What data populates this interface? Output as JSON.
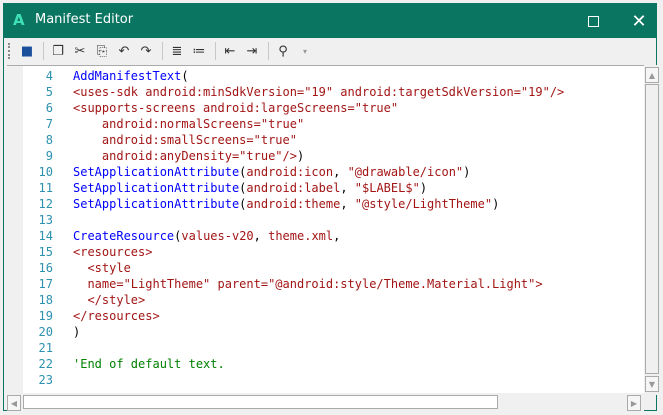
{
  "window": {
    "title": "Manifest Editor",
    "app_icon": "A"
  },
  "toolbar": {
    "icons": [
      "save-icon",
      "copy-icon",
      "cut-icon",
      "paste-icon",
      "undo-icon",
      "redo-icon",
      "indent-icon",
      "comment-icon",
      "outdent-icon",
      "indent-more-icon",
      "find-icon"
    ]
  },
  "editor": {
    "lines": [
      {
        "n": "4",
        "segs": [
          [
            "fn",
            "AddManifestText"
          ],
          [
            "p",
            "("
          ]
        ]
      },
      {
        "n": "5",
        "segs": [
          [
            "str",
            "<uses-sdk android:minSdkVersion=\"19\" android:targetSdkVersion=\"19\"/>"
          ]
        ]
      },
      {
        "n": "6",
        "segs": [
          [
            "str",
            "<supports-screens android:largeScreens=\"true\""
          ]
        ]
      },
      {
        "n": "7",
        "segs": [
          [
            "str",
            "    android:normalScreens=\"true\""
          ]
        ]
      },
      {
        "n": "8",
        "segs": [
          [
            "str",
            "    android:smallScreens=\"true\""
          ]
        ]
      },
      {
        "n": "9",
        "segs": [
          [
            "str",
            "    android:anyDensity=\"true\"/>"
          ],
          [
            "p",
            ")"
          ]
        ]
      },
      {
        "n": "10",
        "segs": [
          [
            "fn",
            "SetApplicationAttribute"
          ],
          [
            "p",
            "("
          ],
          [
            "str",
            "android:icon"
          ],
          [
            "p",
            ", "
          ],
          [
            "str",
            "\"@drawable/icon\""
          ],
          [
            "p",
            ")"
          ]
        ]
      },
      {
        "n": "11",
        "segs": [
          [
            "fn",
            "SetApplicationAttribute"
          ],
          [
            "p",
            "("
          ],
          [
            "str",
            "android:label"
          ],
          [
            "p",
            ", "
          ],
          [
            "str",
            "\"$LABEL$\""
          ],
          [
            "p",
            ")"
          ]
        ]
      },
      {
        "n": "12",
        "segs": [
          [
            "fn",
            "SetApplicationAttribute"
          ],
          [
            "p",
            "("
          ],
          [
            "str",
            "android:theme"
          ],
          [
            "p",
            ", "
          ],
          [
            "str",
            "\"@style/LightTheme\""
          ],
          [
            "p",
            ")"
          ]
        ]
      },
      {
        "n": "13",
        "segs": []
      },
      {
        "n": "14",
        "segs": [
          [
            "fn",
            "CreateResource"
          ],
          [
            "p",
            "("
          ],
          [
            "str",
            "values-v20"
          ],
          [
            "p",
            ", "
          ],
          [
            "str",
            "theme.xml"
          ],
          [
            "p",
            ","
          ]
        ]
      },
      {
        "n": "15",
        "segs": [
          [
            "str",
            "<resources>"
          ]
        ]
      },
      {
        "n": "16",
        "segs": [
          [
            "str",
            "  <style"
          ]
        ]
      },
      {
        "n": "17",
        "segs": [
          [
            "str",
            "  name=\"LightTheme\" parent=\"@android:style/Theme.Material.Light\">"
          ]
        ]
      },
      {
        "n": "18",
        "segs": [
          [
            "str",
            "  </style>"
          ]
        ]
      },
      {
        "n": "19",
        "segs": [
          [
            "str",
            "</resources>"
          ]
        ]
      },
      {
        "n": "20",
        "segs": [
          [
            "p",
            ")"
          ]
        ]
      },
      {
        "n": "21",
        "segs": []
      },
      {
        "n": "22",
        "segs": [
          [
            "cm",
            "'End of default text."
          ]
        ]
      },
      {
        "n": "23",
        "segs": []
      }
    ]
  }
}
